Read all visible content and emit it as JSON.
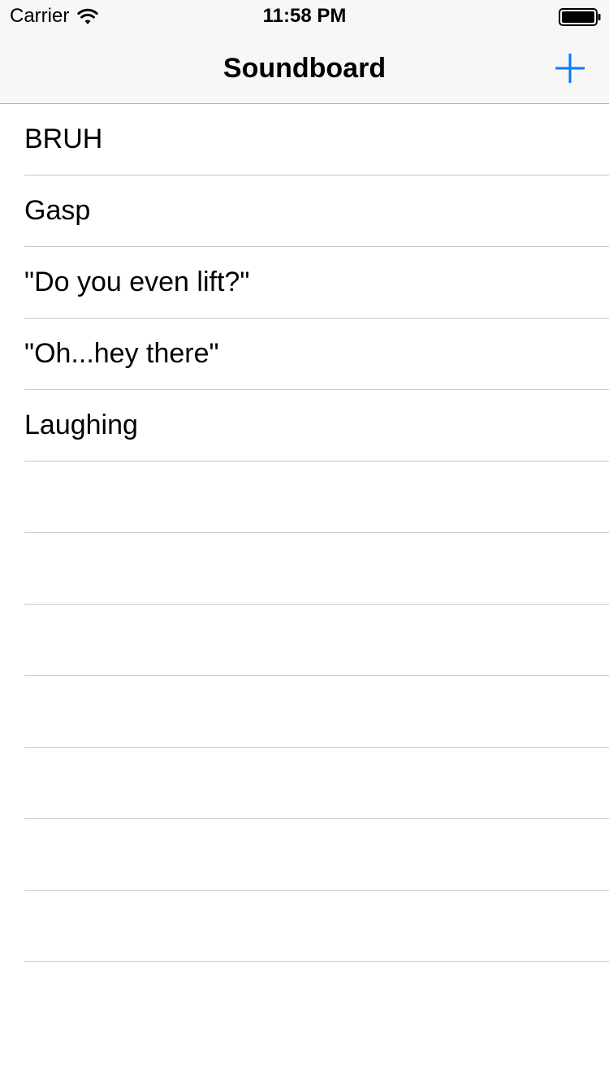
{
  "status_bar": {
    "carrier": "Carrier",
    "time": "11:58 PM",
    "wifi_icon": "wifi-icon",
    "battery_icon": "battery-full-icon"
  },
  "nav": {
    "title": "Soundboard",
    "add_icon": "plus-icon",
    "accent_color": "#007aff"
  },
  "sounds": [
    {
      "label": "BRUH"
    },
    {
      "label": "Gasp"
    },
    {
      "label": "\"Do you even lift?\""
    },
    {
      "label": "\"Oh...hey there\""
    },
    {
      "label": "Laughing"
    },
    {
      "label": ""
    },
    {
      "label": ""
    },
    {
      "label": ""
    },
    {
      "label": ""
    },
    {
      "label": ""
    },
    {
      "label": ""
    },
    {
      "label": ""
    }
  ],
  "colors": {
    "nav_background": "#f7f7f7",
    "separator": "#c8c7cc",
    "text": "#000000"
  }
}
